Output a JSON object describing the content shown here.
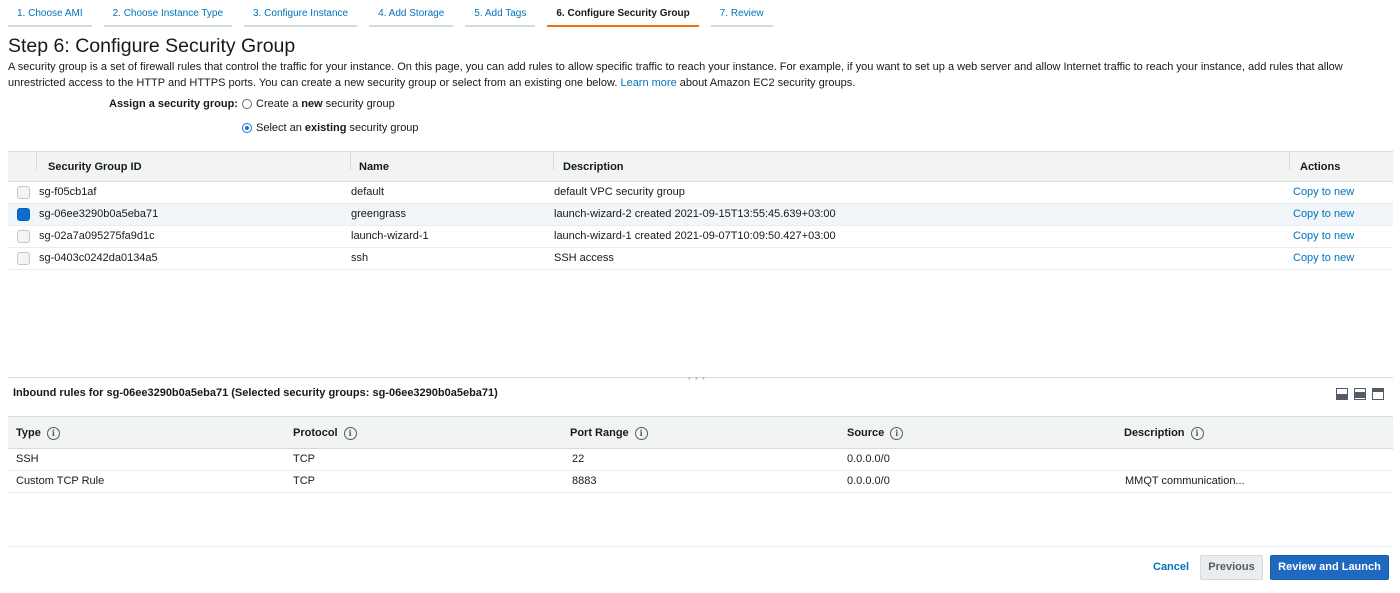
{
  "wizard": {
    "tabs": [
      {
        "label": "1. Choose AMI"
      },
      {
        "label": "2. Choose Instance Type"
      },
      {
        "label": "3. Configure Instance"
      },
      {
        "label": "4. Add Storage"
      },
      {
        "label": "5. Add Tags"
      },
      {
        "label": "6. Configure Security Group"
      },
      {
        "label": "7. Review"
      }
    ],
    "active_tab": 5
  },
  "page": {
    "title": "Step 6: Configure Security Group",
    "intro_text": "A security group is a set of firewall rules that control the traffic for your instance. On this page, you can add rules to allow specific traffic to reach your instance. For example, if you want to set up a web server and allow Internet traffic to reach your instance, add rules that allow unrestricted access to the HTTP and HTTPS ports. You can create a new security group or select from an existing one below.",
    "learn_more": "Learn more",
    "intro_suffix": "about Amazon EC2 security groups."
  },
  "assign": {
    "label": "Assign a security group:",
    "options": [
      {
        "pre": "Create a",
        "bold": "new",
        "post": "security group",
        "checked": false
      },
      {
        "pre": "Select an",
        "bold": "existing",
        "post": "security group",
        "checked": true
      }
    ]
  },
  "sg_table": {
    "headers": {
      "id": "Security Group ID",
      "name": "Name",
      "description": "Description",
      "actions": "Actions"
    },
    "rows": [
      {
        "id": "sg-f05cb1af",
        "name": "default",
        "description": "default VPC security group",
        "action": "Copy to new",
        "checked": false
      },
      {
        "id": "sg-06ee3290b0a5eba71",
        "name": "greengrass",
        "description": "launch-wizard-2 created 2021-09-15T13:55:45.639+03:00",
        "action": "Copy to new",
        "checked": true
      },
      {
        "id": "sg-02a7a095275fa9d1c",
        "name": "launch-wizard-1",
        "description": "launch-wizard-1 created 2021-09-07T10:09:50.427+03:00",
        "action": "Copy to new",
        "checked": false
      },
      {
        "id": "sg-0403c0242da0134a5",
        "name": "ssh",
        "description": "SSH access",
        "action": "Copy to new",
        "checked": false
      }
    ]
  },
  "inbound": {
    "title": "Inbound rules for sg-06ee3290b0a5eba71 (Selected security groups: sg-06ee3290b0a5eba71)",
    "headers": {
      "type": "Type",
      "protocol": "Protocol",
      "port_range": "Port Range",
      "source": "Source",
      "description": "Description"
    },
    "info_glyph": "i",
    "rows": [
      {
        "type": "SSH",
        "protocol": "TCP",
        "port_range": "22",
        "source": "0.0.0.0/0",
        "description": ""
      },
      {
        "type": "Custom TCP Rule",
        "protocol": "TCP",
        "port_range": "8883",
        "source": "0.0.0.0/0",
        "description": "MMQT communication..."
      }
    ]
  },
  "footer": {
    "cancel": "Cancel",
    "previous": "Previous",
    "review_launch": "Review and Launch"
  },
  "colors": {
    "link": "#0073bb",
    "active_tab_underline": "#ec7211",
    "primary_button": "#1f6ac0",
    "selected_row": "#f1f6fb"
  }
}
